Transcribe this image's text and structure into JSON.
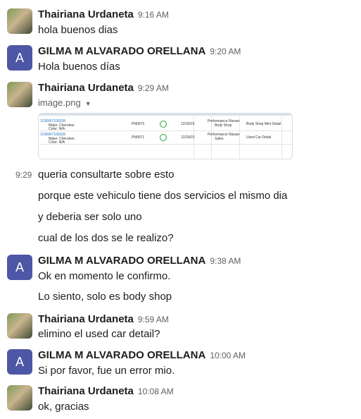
{
  "messages": [
    {
      "author": "Thairiana Urdaneta",
      "time": "9:16 AM",
      "avatar": "photo",
      "lines": [
        "hola buenos dias"
      ]
    },
    {
      "author": "GILMA M ALVARADO ORELLANA",
      "time": "9:20 AM",
      "avatar": "A",
      "lines": [
        "Hola buenos días"
      ]
    },
    {
      "author": "Thairiana Urdaneta",
      "time": "9:29 AM",
      "avatar": "photo",
      "attachment": {
        "filename": "image.png",
        "rows": [
          {
            "id": "1C6RR7100328",
            "sub": "Make: Cherokee",
            "sub2": "Color: N/A",
            "code": "PN0573",
            "date": "12/29/23",
            "dept": "Performance Nissan",
            "dept2": "Body Shop",
            "service": "Body Shop Mini Detail"
          },
          {
            "id": "1C6RR7100328",
            "sub": "Make: Cherokee",
            "sub2": "Color: N/A",
            "code": "PN0571",
            "date": "12/29/23",
            "dept": "Performance Nissan",
            "dept2": "Sales",
            "service": "Used Car Detail"
          }
        ]
      }
    },
    {
      "hover_time": "9:29",
      "lines": [
        "queria consultarte sobre esto",
        "porque este vehiculo tiene dos servicios el mismo dia",
        "y deberia ser solo uno",
        "cual de los dos se le realizo?"
      ]
    },
    {
      "author": "GILMA M ALVARADO ORELLANA",
      "time": "9:38 AM",
      "avatar": "A",
      "lines": [
        "Ok en momento le confirmo.",
        "Lo siento, solo es body shop"
      ]
    },
    {
      "author": "Thairiana Urdaneta",
      "time": "9:59 AM",
      "avatar": "photo",
      "lines": [
        "elimino el used car detail?"
      ]
    },
    {
      "author": "GILMA M ALVARADO ORELLANA",
      "time": "10:00 AM",
      "avatar": "A",
      "lines": [
        "Si por favor, fue un error mio."
      ]
    },
    {
      "author": "Thairiana Urdaneta",
      "time": "10:08 AM",
      "avatar": "photo",
      "lines": [
        "ok, gracias"
      ]
    }
  ]
}
